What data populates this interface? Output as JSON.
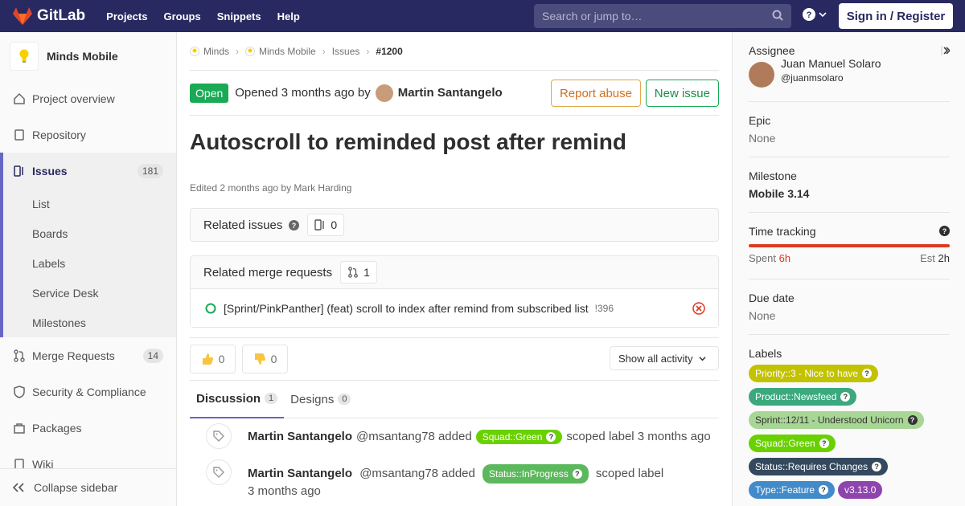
{
  "navbar": {
    "brand": "GitLab",
    "links": [
      "Projects",
      "Groups",
      "Snippets",
      "Help"
    ],
    "search_placeholder": "Search or jump to…",
    "sign_in": "Sign in / Register"
  },
  "sidebar": {
    "project_name": "Minds Mobile",
    "items": [
      {
        "label": "Project overview",
        "icon": "home-icon"
      },
      {
        "label": "Repository",
        "icon": "book-icon"
      },
      {
        "label": "Issues",
        "count": "181",
        "icon": "issues-icon"
      }
    ],
    "sub_items": [
      "List",
      "Boards",
      "Labels",
      "Service Desk",
      "Milestones"
    ],
    "items_after": [
      {
        "label": "Merge Requests",
        "count": "14",
        "icon": "merge-request-icon"
      },
      {
        "label": "Security & Compliance",
        "icon": "shield-icon"
      },
      {
        "label": "Packages",
        "icon": "package-icon"
      },
      {
        "label": "Wiki",
        "icon": "book-icon"
      }
    ],
    "collapse_label": "Collapse sidebar"
  },
  "breadcrumb": {
    "items": [
      "Minds",
      "Minds Mobile",
      "Issues"
    ],
    "current": "#1200"
  },
  "issue": {
    "status": "Open",
    "opened_text": "Opened 3 months ago by",
    "author": "Martin Santangelo",
    "report_abuse": "Report abuse",
    "new_issue": "New issue",
    "title": "Autoscroll to reminded post after remind",
    "edited_text": "Edited 2 months ago by Mark Harding"
  },
  "related_issues": {
    "title": "Related issues",
    "count": "0"
  },
  "related_mrs": {
    "title": "Related merge requests",
    "count": "1",
    "items": [
      {
        "title": "[Sprint/PinkPanther] (feat) scroll to index after remind from subscribed list",
        "ref": "!396"
      }
    ]
  },
  "awards": {
    "thumbsup": "0",
    "thumbsdown": "0",
    "activity_filter": "Show all activity"
  },
  "tabs": [
    {
      "label": "Discussion",
      "count": "1"
    },
    {
      "label": "Designs",
      "count": "0"
    }
  ],
  "notes": [
    {
      "author": "Martin Santangelo",
      "handle": "@msantang78 added",
      "label": "Squad::Green",
      "label_color": "#69d100",
      "suffix": "scoped label 3 months ago"
    },
    {
      "author": "Martin Santangelo",
      "handle": "@msantang78 added",
      "label": "Status::InProgress",
      "label_color": "#5cb85c",
      "suffix": "scoped label",
      "time": "3 months ago"
    }
  ],
  "right_sidebar": {
    "assignee_title": "Assignee",
    "assignee_name": "Juan Manuel Solaro",
    "assignee_handle": "@juanmsolaro",
    "epic_title": "Epic",
    "epic_value": "None",
    "milestone_title": "Milestone",
    "milestone_value": "Mobile 3.14",
    "time_title": "Time tracking",
    "spent_label": "Spent",
    "spent_value": "6h",
    "est_label": "Est",
    "est_value": "2h",
    "due_title": "Due date",
    "due_value": "None",
    "labels_title": "Labels",
    "labels": [
      {
        "text": "Priority::3 - Nice to have",
        "color": "#c2c200",
        "scoped": true
      },
      {
        "text": "Product::Newsfeed",
        "color": "#3aa97e",
        "scoped": true
      },
      {
        "text": "Sprint::12/11 - Understood Unicorn",
        "color": "#a8d695",
        "scoped": true,
        "dark": true
      },
      {
        "text": "Squad::Green",
        "color": "#69d100",
        "scoped": true
      },
      {
        "text": "Status::Requires Changes",
        "color": "#34495e",
        "scoped": true
      },
      {
        "text": "Type::Feature",
        "color": "#428bca",
        "scoped": true
      },
      {
        "text": "v3.13.0",
        "color": "#8e44ad",
        "scoped": false
      }
    ]
  }
}
